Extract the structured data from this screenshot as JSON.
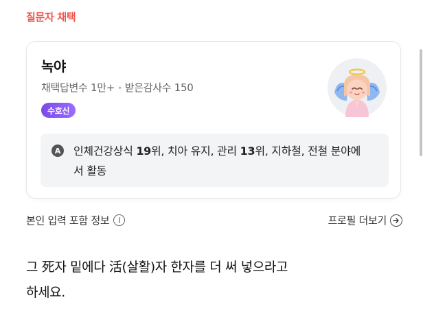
{
  "section": {
    "label": "질문자 채택"
  },
  "profile": {
    "name": "녹야",
    "stats_adopted": "채택답변수 1만+",
    "stats_separator": "•",
    "stats_thanks": "받은감사수 150",
    "badge": "수호신",
    "fields": {
      "icon_letter": "A",
      "parts": [
        {
          "text": "인체건강상식 "
        },
        {
          "text": "19",
          "bold": true
        },
        {
          "text": "위, 치아 유지, 관리 "
        },
        {
          "text": "13",
          "bold": true
        },
        {
          "text": "위, 지하철, 전철 분야에서 활동"
        }
      ]
    }
  },
  "info": {
    "left_label": "본인 입력 포함 정보",
    "right_label": "프로필 더보기"
  },
  "answer": {
    "line1": "그 死자 밑에다 活(살활)자 한자를 더 써 넣으라고",
    "line2": "하세요."
  },
  "colors": {
    "section_label": "#f2554c",
    "badge_start": "#7a4be8",
    "badge_end": "#9a6bff",
    "fields_bg": "#f3f4f6"
  }
}
